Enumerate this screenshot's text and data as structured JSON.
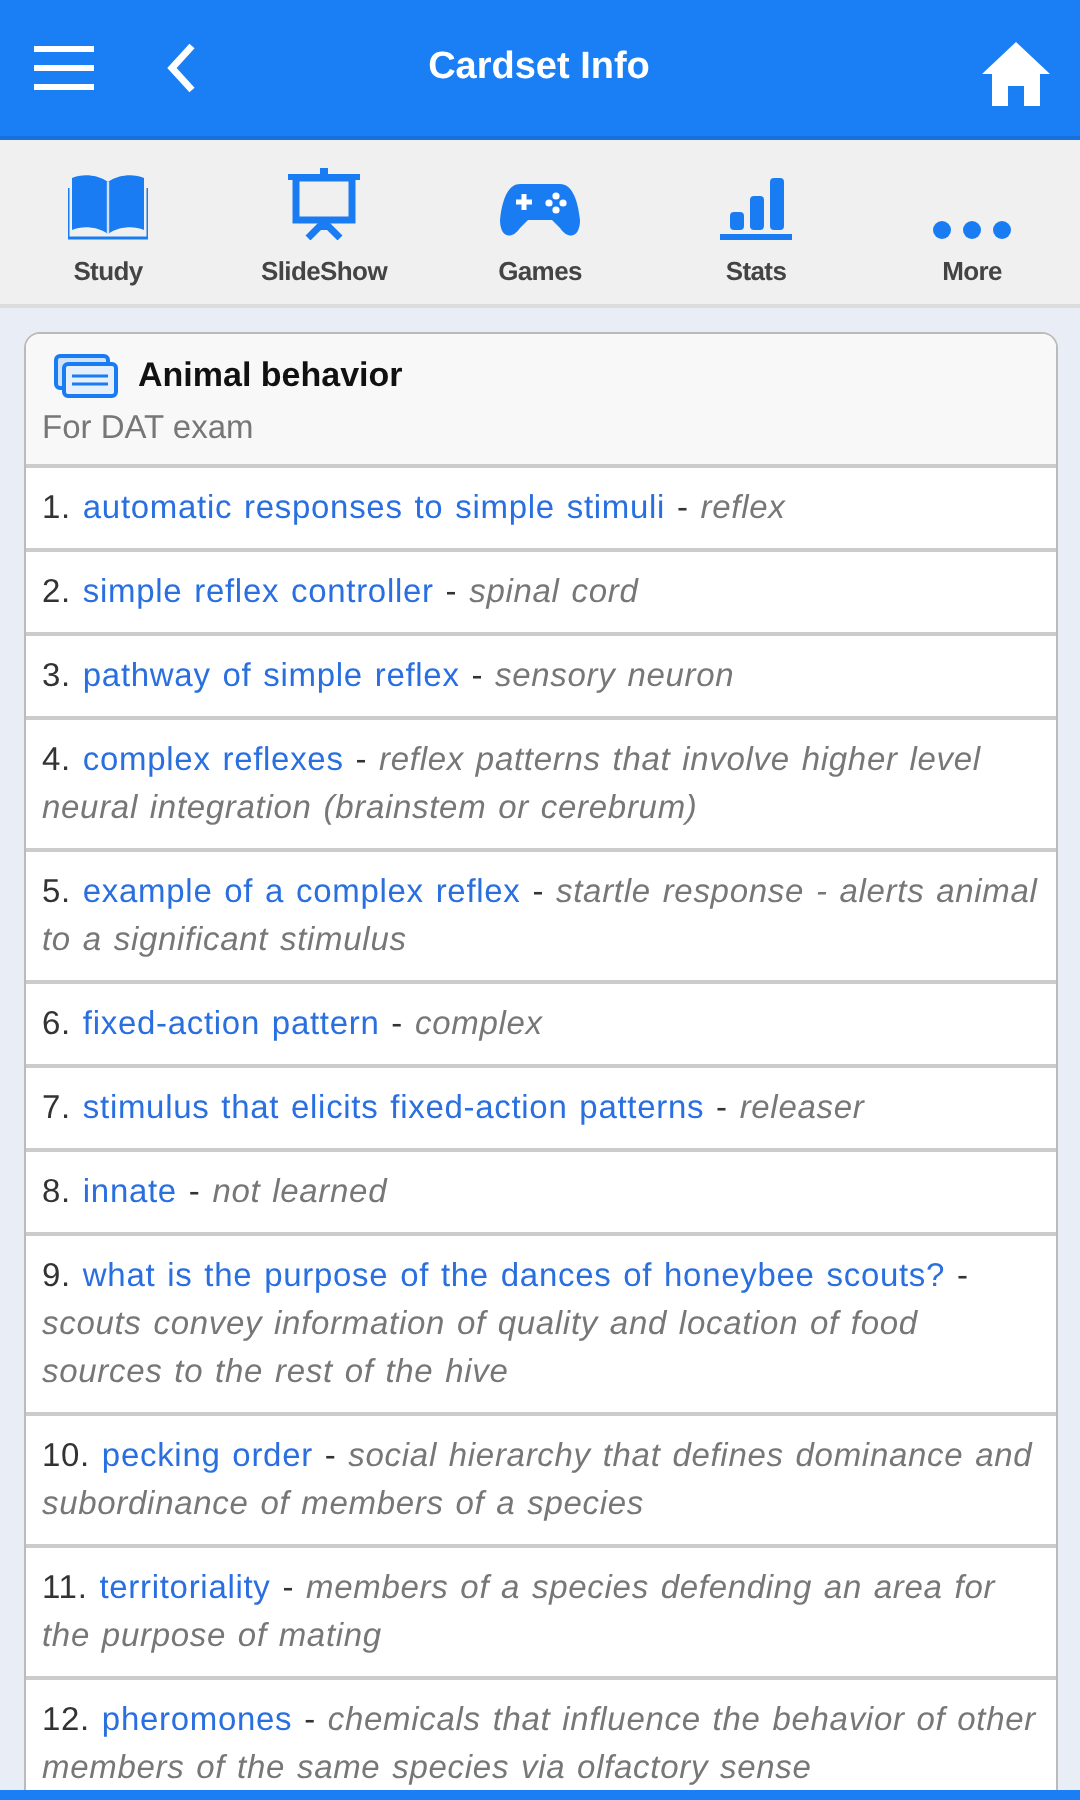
{
  "header": {
    "title": "Cardset Info"
  },
  "toolbar": [
    {
      "label": "Study"
    },
    {
      "label": "SlideShow"
    },
    {
      "label": "Games"
    },
    {
      "label": "Stats"
    },
    {
      "label": "More"
    }
  ],
  "cardset": {
    "title": "Animal behavior",
    "description": "For DAT exam",
    "separator": "-",
    "entries": [
      {
        "number": "1.",
        "term": "automatic responses to simple stimuli",
        "definition": "reflex"
      },
      {
        "number": "2.",
        "term": "simple reflex controller",
        "definition": "spinal cord"
      },
      {
        "number": "3.",
        "term": "pathway of simple reflex",
        "definition": "sensory neuron"
      },
      {
        "number": "4.",
        "term": "complex reflexes",
        "definition": "reflex patterns that involve higher level neural integration (brainstem or cerebrum)"
      },
      {
        "number": "5.",
        "term": "example of a complex reflex",
        "definition": "startle response - alerts animal to a significant stimulus"
      },
      {
        "number": "6.",
        "term": "fixed-action pattern",
        "definition": "complex"
      },
      {
        "number": "7.",
        "term": "stimulus that elicits fixed-action patterns",
        "definition": "releaser"
      },
      {
        "number": "8.",
        "term": "innate",
        "definition": "not learned"
      },
      {
        "number": "9.",
        "term": "what is the purpose of the dances of honeybee scouts?",
        "definition": "scouts convey information of quality and location of food sources to the rest of the hive"
      },
      {
        "number": "10.",
        "term": "pecking order",
        "definition": "social hierarchy that defines dominance and subordinance of members of a species"
      },
      {
        "number": "11.",
        "term": "territoriality",
        "definition": "members of a species defending an area for the purpose of mating"
      },
      {
        "number": "12.",
        "term": "pheromones",
        "definition": "chemicals that influence the behavior of other members of the same species via olfactory sense"
      }
    ]
  }
}
